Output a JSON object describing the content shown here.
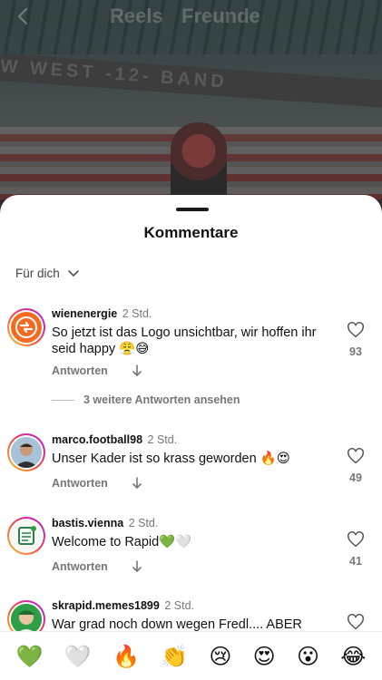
{
  "top_nav": {
    "tabs": [
      "Reels",
      "Freunde"
    ]
  },
  "background": {
    "banner_text": "W WEST -12- BAND"
  },
  "sheet": {
    "title": "Kommentare",
    "sort_label": "Für dich"
  },
  "comments": [
    {
      "username": "wienenergie",
      "time": "2 Std.",
      "text": "So jetzt ist das Logo unsichtbar, wir hoffen ihr seid happy 😤😅",
      "reply_label": "Antworten",
      "likes": "93",
      "more_replies": "3 weitere Antworten ansehen"
    },
    {
      "username": "marco.football98",
      "time": "2 Std.",
      "text": "Unser Kader ist so krass geworden 🔥😍",
      "reply_label": "Antworten",
      "likes": "49"
    },
    {
      "username": "bastis.vienna",
      "time": "2 Std.",
      "text": "Welcome to Rapid💚🤍",
      "reply_label": "Antworten",
      "likes": "41"
    },
    {
      "username": "skrapid.memes1899",
      "time": "2 Std.",
      "text": "War grad noch down wegen Fredl.... ABER"
    }
  ],
  "emoji_bar": [
    "💚",
    "🤍",
    "🔥",
    "👏",
    "😢",
    "😍",
    "😮",
    "😂"
  ],
  "colors": {
    "accent_green": "#2e9e47",
    "brand_orange": "#f26b21",
    "muted_text": "#777777"
  }
}
